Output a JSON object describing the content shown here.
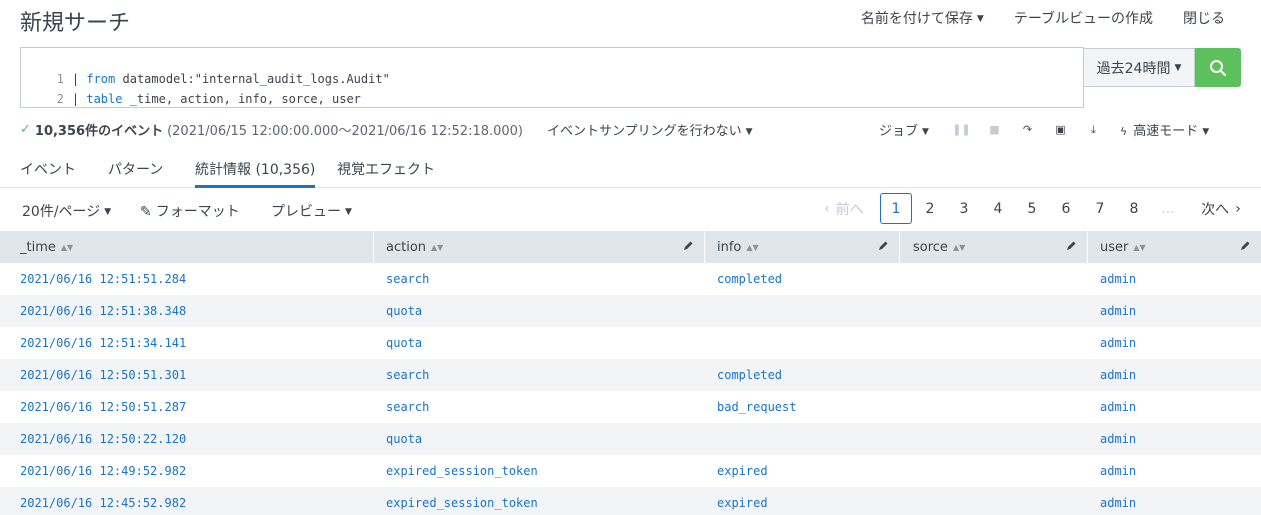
{
  "header": {
    "title": "新規サーチ",
    "save_as": "名前を付けて保存",
    "create_table_view": "テーブルビューの作成",
    "close": "閉じる"
  },
  "search": {
    "lines": [
      {
        "num": "1",
        "pipe": "| ",
        "keyword": "from",
        "rest": " datamodel:\"internal_audit_logs.Audit\""
      },
      {
        "num": "2",
        "pipe": "| ",
        "keyword": "table",
        "rest": " _time, action, info, sorce, user"
      }
    ],
    "time_range": "過去24時間"
  },
  "status": {
    "events": "10,356件のイベント",
    "range": "(2021/06/15 12:00:00.000〜2021/06/16 12:52:18.000)",
    "sampling": "イベントサンプリングを行わない",
    "job": "ジョブ",
    "mode": "高速モード"
  },
  "tabs": [
    {
      "label": "イベント"
    },
    {
      "label": "パターン"
    },
    {
      "label": "統計情報 (10,356)"
    },
    {
      "label": "視覚エフェクト"
    }
  ],
  "toolbar": {
    "per_page": "20件/ページ",
    "format": "フォーマット",
    "preview": "プレビュー"
  },
  "pager": {
    "prev": "前へ",
    "pages": [
      "1",
      "2",
      "3",
      "4",
      "5",
      "6",
      "7",
      "8"
    ],
    "ellipsis": "...",
    "next": "次へ"
  },
  "table": {
    "columns": [
      "_time",
      "action",
      "info",
      "sorce",
      "user"
    ],
    "rows": [
      [
        "2021/06/16 12:51:51.284",
        "search",
        "completed",
        "",
        "admin"
      ],
      [
        "2021/06/16 12:51:38.348",
        "quota",
        "",
        "",
        "admin"
      ],
      [
        "2021/06/16 12:51:34.141",
        "quota",
        "",
        "",
        "admin"
      ],
      [
        "2021/06/16 12:50:51.301",
        "search",
        "completed",
        "",
        "admin"
      ],
      [
        "2021/06/16 12:50:51.287",
        "search",
        "bad_request",
        "",
        "admin"
      ],
      [
        "2021/06/16 12:50:22.120",
        "quota",
        "",
        "",
        "admin"
      ],
      [
        "2021/06/16 12:49:52.982",
        "expired_session_token",
        "expired",
        "",
        "admin"
      ],
      [
        "2021/06/16 12:45:52.982",
        "expired_session_token",
        "expired",
        "",
        "admin"
      ]
    ]
  },
  "colors": {
    "link": "#1a73c7",
    "go_button": "#5cc05c",
    "header_bg": "#e1e6eb",
    "stripe": "#f2f4f5"
  }
}
